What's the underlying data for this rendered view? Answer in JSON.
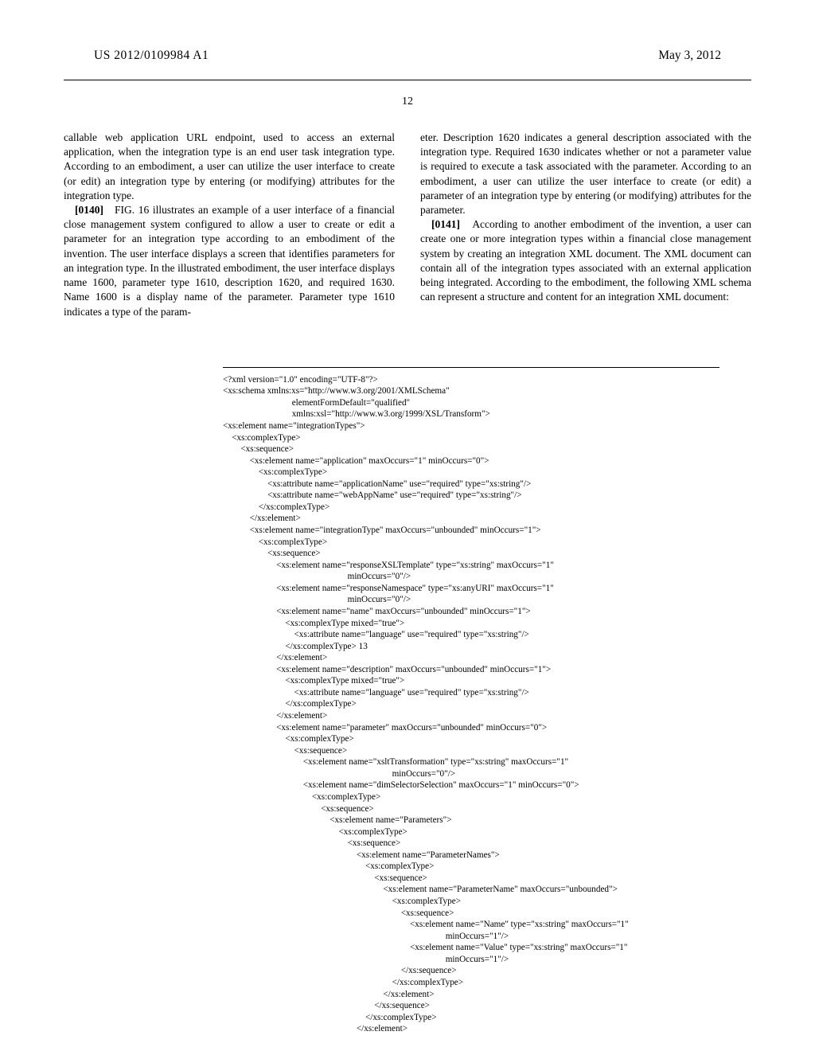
{
  "header": {
    "publication_number": "US 2012/0109984 A1",
    "date": "May 3, 2012"
  },
  "page_number": "12",
  "columns": {
    "left": {
      "p1": "callable web application URL endpoint, used to access an external application, when the integration type is an end user task integration type. According to an embodiment, a user can utilize the user interface to create (or edit) an integration type by entering (or modifying) attributes for the integration type.",
      "p2_label": "[0140]",
      "p2": "FIG. 16 illustrates an example of a user interface of a financial close management system configured to allow a user to create or edit a parameter for an integration type according to an embodiment of the invention. The user interface displays a screen that identifies parameters for an integration type. In the illustrated embodiment, the user interface displays name 1600, parameter type 1610, description 1620, and required 1630. Name 1600 is a display name of the parameter. Parameter type 1610 indicates a type of the param-"
    },
    "right": {
      "p1": "eter. Description 1620 indicates a general description associated with the integration type. Required 1630 indicates whether or not a parameter value is required to execute a task associated with the parameter. According to an embodiment, a user can utilize the user interface to create (or edit) a parameter of an integration type by entering (or modifying) attributes for the parameter.",
      "p2_label": "[0141]",
      "p2": "According to another embodiment of the invention, a user can create one or more integration types within a financial close management system by creating an integration XML document. The XML document can contain all of the integration types associated with an external application being integrated. According to the embodiment, the following XML schema can represent a structure and content for an integration XML document:"
    }
  },
  "code": "<?xml version=\"1.0\" encoding=\"UTF-8\"?>\n<xs:schema xmlns:xs=\"http://www.w3.org/2001/XMLSchema\"\n                               elementFormDefault=\"qualified\"\n                               xmlns:xsl=\"http://www.w3.org/1999/XSL/Transform\">\n<xs:element name=\"integrationTypes\">\n    <xs:complexType>\n        <xs:sequence>\n            <xs:element name=\"application\" maxOccurs=\"1\" minOccurs=\"0\">\n                <xs:complexType>\n                    <xs:attribute name=\"applicationName\" use=\"required\" type=\"xs:string\"/>\n                    <xs:attribute name=\"webAppName\" use=\"required\" type=\"xs:string\"/>\n                </xs:complexType>\n            </xs:element>\n            <xs:element name=\"integrationType\" maxOccurs=\"unbounded\" minOccurs=\"1\">\n                <xs:complexType>\n                    <xs:sequence>\n                        <xs:element name=\"responseXSLTemplate\" type=\"xs:string\" maxOccurs=\"1\"\n                                                        minOccurs=\"0\"/>\n                        <xs:element name=\"responseNamespace\" type=\"xs:anyURI\" maxOccurs=\"1\"\n                                                        minOccurs=\"0\"/>\n                        <xs:element name=\"name\" maxOccurs=\"unbounded\" minOccurs=\"1\">\n                            <xs:complexType mixed=\"true\">\n                                <xs:attribute name=\"language\" use=\"required\" type=\"xs:string\"/>\n                            </xs:complexType> 13\n                        </xs:element>\n                        <xs:element name=\"description\" maxOccurs=\"unbounded\" minOccurs=\"1\">\n                            <xs:complexType mixed=\"true\">\n                                <xs:attribute name=\"language\" use=\"required\" type=\"xs:string\"/>\n                            </xs:complexType>\n                        </xs:element>\n                        <xs:element name=\"parameter\" maxOccurs=\"unbounded\" minOccurs=\"0\">\n                            <xs:complexType>\n                                <xs:sequence>\n                                    <xs:element name=\"xsltTransformation\" type=\"xs:string\" maxOccurs=\"1\"\n                                                                            minOccurs=\"0\"/>\n                                    <xs:element name=\"dimSelectorSelection\" maxOccurs=\"1\" minOccurs=\"0\">\n                                        <xs:complexType>\n                                            <xs:sequence>\n                                                <xs:element name=\"Parameters\">\n                                                    <xs:complexType>\n                                                        <xs:sequence>\n                                                            <xs:element name=\"ParameterNames\">\n                                                                <xs:complexType>\n                                                                    <xs:sequence>\n                                                                        <xs:element name=\"ParameterName\" maxOccurs=\"unbounded\">\n                                                                            <xs:complexType>\n                                                                                <xs:sequence>\n                                                                                    <xs:element name=\"Name\" type=\"xs:string\" maxOccurs=\"1\"\n                                                                                                    minOccurs=\"1\"/>\n                                                                                    <xs:element name=\"Value\" type=\"xs:string\" maxOccurs=\"1\"\n                                                                                                    minOccurs=\"1\"/>\n                                                                                </xs:sequence>\n                                                                            </xs:complexType>\n                                                                        </xs:element>\n                                                                    </xs:sequence>\n                                                                </xs:complexType>\n                                                            </xs:element>"
}
